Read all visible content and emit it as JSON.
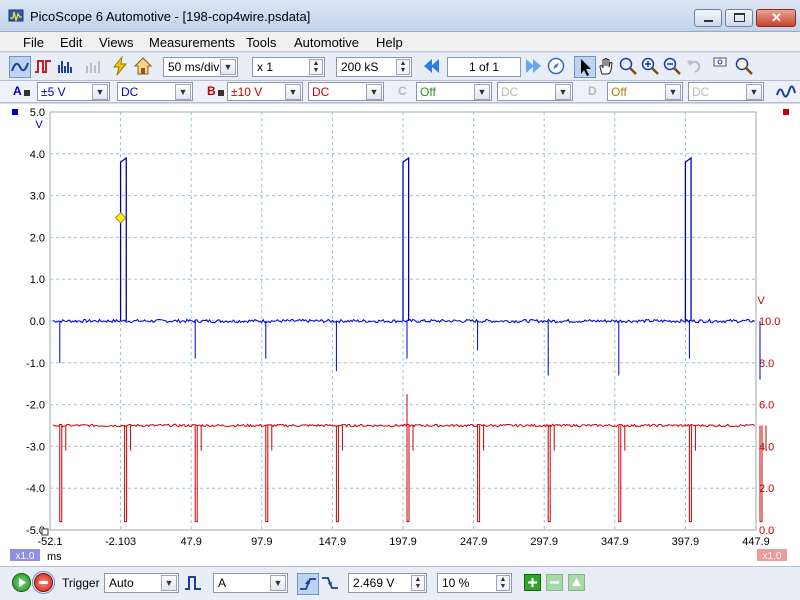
{
  "window": {
    "title": "PicoScope 6 Automotive - [198-cop4wire.psdata]"
  },
  "menu": [
    "File",
    "Edit",
    "Views",
    "Measurements",
    "Tools",
    "Automotive",
    "Help"
  ],
  "toolbar": {
    "timebase": "50 ms/div",
    "zoom": "x 1",
    "samples": "200 kS",
    "buffer": "1 of 1"
  },
  "channels": {
    "a": {
      "letter": "A",
      "range": "±5 V",
      "coupling": "DC",
      "color": "#0000c8"
    },
    "b": {
      "letter": "B",
      "range": "±10 V",
      "coupling": "DC",
      "color": "#c80000"
    },
    "c": {
      "letter": "C",
      "range": "Off",
      "coupling": "DC"
    },
    "d": {
      "letter": "D",
      "range": "Off",
      "coupling": "DC"
    }
  },
  "trigger": {
    "label": "Trigger",
    "mode": "Auto",
    "source": "A",
    "level": "2.469 V",
    "pretrigger": "10 %"
  },
  "chart_data": {
    "type": "line",
    "x": {
      "unit": "ms",
      "ticks": [
        "-52.1",
        "-2.103",
        "47.9",
        "97.9",
        "147.9",
        "197.9",
        "247.9",
        "297.9",
        "347.9",
        "397.9",
        "447.9"
      ],
      "range": [
        -52.1,
        447.9
      ],
      "scale_badge": "x1.0"
    },
    "y_left": {
      "unit": "V",
      "ticks": [
        "5.0",
        "4.0",
        "3.0",
        "2.0",
        "1.0",
        "0.0",
        "-1.0",
        "-2.0",
        "-3.0",
        "-4.0",
        "-5.0"
      ],
      "range": [
        -5,
        5
      ]
    },
    "y_right": {
      "unit": "V",
      "ticks": [
        "10.0",
        "8.0",
        "6.0",
        "4.0",
        "2.0",
        "0.0"
      ],
      "range": [
        0,
        10
      ],
      "scale_badge": "x1.0"
    },
    "grid": true,
    "series": [
      {
        "channel": "A",
        "baseline": 0.0,
        "pulse_high": 3.9,
        "pulses_ms": [
          -2.1,
          197.9,
          397.9
        ],
        "pulse_width_ms": 4,
        "negative_spikes_ms": [
          -48,
          47.9,
          97.9,
          147.9,
          197.9,
          247.9,
          297.9,
          347.9,
          397.9,
          447.9
        ],
        "spike_depths": [
          -1.0,
          -0.9,
          -0.9,
          -1.2,
          -0.9,
          -0.7,
          -1.3,
          -1.3,
          -0.9,
          -1.4
        ]
      },
      {
        "channel": "B",
        "baseline": 5.0,
        "dip_low": 0.4,
        "dips_ms": [
          -48,
          -2.1,
          47.9,
          97.9,
          147.9,
          197.9,
          247.9,
          297.9,
          347.9,
          397.9,
          447.9
        ],
        "spike_high_ms": 197.9,
        "spike_high": 6.5
      }
    ],
    "trigger_marker": {
      "time_ms": -2.1,
      "level_v": 2.469
    }
  }
}
